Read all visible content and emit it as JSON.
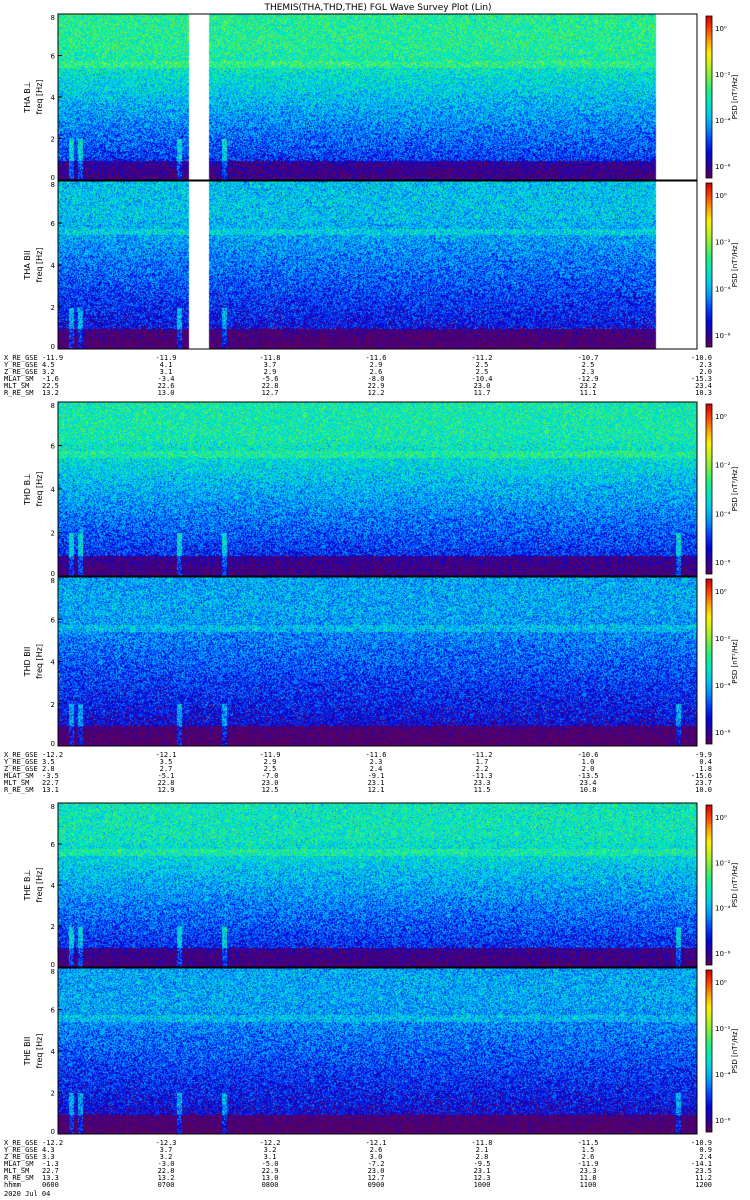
{
  "figure": {
    "title": "THEMIS(THA,THD,THE) FGL Wave Survey Plot (Lin)",
    "date_label": "2020 Jul 04"
  },
  "colors": {
    "colormap": [
      "#5a0060",
      "#2c00a0",
      "#0008d8",
      "#0040ff",
      "#0090ff",
      "#00c8f0",
      "#00e8c0",
      "#20f080",
      "#70f040",
      "#c0f020",
      "#fff000",
      "#ffa000",
      "#ff4000",
      "#d00000"
    ],
    "background": "#ffffff",
    "axis": "#000000"
  },
  "chart_data": [
    {
      "type": "heatmap",
      "id": "THA_BL",
      "ylabel_top": "THA B⊥",
      "ylabel": "freq [Hz]",
      "ylim": [
        0,
        8
      ],
      "yticks": [
        "0",
        "2",
        "4",
        "6",
        "8"
      ],
      "zlabel": "PSD [nT²/Hz]",
      "zticks": [
        "10⁰",
        "10⁻²",
        "10⁻⁴",
        "10⁻⁶"
      ],
      "zscale": "log",
      "xlim": [
        "0600",
        "1200"
      ],
      "background_level": 0.72,
      "data_gaps": [
        [
          0.205,
          0.235
        ],
        [
          0.935,
          1.0
        ]
      ]
    },
    {
      "type": "heatmap",
      "id": "THA_BII",
      "ylabel_top": "THA BII",
      "ylabel": "freq [Hz]",
      "ylim": [
        0,
        8
      ],
      "yticks": [
        "0",
        "2",
        "4",
        "6",
        "8"
      ],
      "zlabel": "PSD [nT²/Hz]",
      "zticks": [
        "10⁰",
        "10⁻²",
        "10⁻⁴",
        "10⁻⁶"
      ],
      "zscale": "log",
      "xlim": [
        "0600",
        "1200"
      ],
      "background_level": 0.55,
      "data_gaps": [
        [
          0.205,
          0.235
        ],
        [
          0.935,
          1.0
        ]
      ]
    },
    {
      "type": "heatmap",
      "id": "THD_BL",
      "ylabel_top": "THD B⊥",
      "ylabel": "freq [Hz]",
      "ylim": [
        0,
        8
      ],
      "yticks": [
        "0",
        "2",
        "4",
        "6",
        "8"
      ],
      "zlabel": "PSD [nT²/Hz]",
      "zticks": [
        "10⁰",
        "10⁻²",
        "10⁻⁴",
        "10⁻⁶"
      ],
      "zscale": "log",
      "xlim": [
        "0600",
        "1200"
      ],
      "background_level": 0.68,
      "data_gaps": []
    },
    {
      "type": "heatmap",
      "id": "THD_BII",
      "ylabel_top": "THD BII",
      "ylabel": "freq [Hz]",
      "ylim": [
        0,
        8
      ],
      "yticks": [
        "0",
        "2",
        "4",
        "6",
        "8"
      ],
      "zlabel": "PSD [nT²/Hz]",
      "zticks": [
        "10⁰",
        "10⁻²",
        "10⁻⁴",
        "10⁻⁶"
      ],
      "zscale": "log",
      "xlim": [
        "0600",
        "1200"
      ],
      "background_level": 0.5,
      "data_gaps": []
    },
    {
      "type": "heatmap",
      "id": "THE_BL",
      "ylabel_top": "THE B⊥",
      "ylabel": "freq [Hz]",
      "ylim": [
        0,
        8
      ],
      "yticks": [
        "0",
        "2",
        "4",
        "6",
        "8"
      ],
      "zlabel": "PSD [nT²/Hz]",
      "zticks": [
        "10⁰",
        "10⁻²",
        "10⁻⁴",
        "10⁻⁶"
      ],
      "zscale": "log",
      "xlim": [
        "0600",
        "1200"
      ],
      "background_level": 0.66,
      "data_gaps": []
    },
    {
      "type": "heatmap",
      "id": "THE_BII",
      "ylabel_top": "THE BII",
      "ylabel": "freq [Hz]",
      "ylim": [
        0,
        8
      ],
      "yticks": [
        "0",
        "2",
        "4",
        "6",
        "8"
      ],
      "zlabel": "PSD [nT²/Hz]",
      "zticks": [
        "10⁰",
        "10⁻²",
        "10⁻⁴",
        "10⁻⁶"
      ],
      "zscale": "log",
      "xlim": [
        "0600",
        "1200"
      ],
      "background_level": 0.5,
      "data_gaps": []
    }
  ],
  "ephemeris": [
    {
      "probe": "THA",
      "rows": [
        {
          "label": "X_RE_GSE",
          "values": [
            "-11.9",
            "-11.9",
            "-11.8",
            "-11.6",
            "-11.2",
            "-10.7",
            "-10.0"
          ]
        },
        {
          "label": "Y_RE_GSE",
          "values": [
            "4.5",
            "4.1",
            "3.7",
            "2.9",
            "2.5",
            "2.5",
            "2.3"
          ]
        },
        {
          "label": "Z_RE_GSE",
          "values": [
            "3.2",
            "3.1",
            "2.9",
            "2.6",
            "2.5",
            "2.3",
            "2.0"
          ]
        },
        {
          "label": "MLAT_SM",
          "values": [
            "-1.6",
            "-3.4",
            "-5.6",
            "-8.0",
            "-10.4",
            "-12.9",
            "-15.3"
          ]
        },
        {
          "label": "MLT_SM",
          "values": [
            "22.5",
            "22.6",
            "22.8",
            "22.9",
            "23.0",
            "23.2",
            "23.4"
          ]
        },
        {
          "label": "R_RE_SM",
          "values": [
            "13.2",
            "13.0",
            "12.7",
            "12.2",
            "11.7",
            "11.1",
            "10.3"
          ]
        }
      ]
    },
    {
      "probe": "THD",
      "rows": [
        {
          "label": "X_RE_GSE",
          "values": [
            "-12.2",
            "-12.1",
            "-11.9",
            "-11.6",
            "-11.2",
            "-10.6",
            "-9.9"
          ]
        },
        {
          "label": "Y_RE_GSE",
          "values": [
            "3.5",
            "3.5",
            "2.9",
            "2.3",
            "1.7",
            "1.0",
            "0.4"
          ]
        },
        {
          "label": "Z_RE_GSE",
          "values": [
            "2.8",
            "2.7",
            "2.5",
            "2.4",
            "2.2",
            "2.0",
            "1.8"
          ]
        },
        {
          "label": "MLAT_SM",
          "values": [
            "-3.5",
            "-5.1",
            "-7.0",
            "-9.1",
            "-11.3",
            "-13.5",
            "-15.6"
          ]
        },
        {
          "label": "MLT_SM",
          "values": [
            "22.7",
            "22.8",
            "23.0",
            "23.1",
            "23.3",
            "23.4",
            "23.7"
          ]
        },
        {
          "label": "R_RE_SM",
          "values": [
            "13.1",
            "12.9",
            "12.5",
            "12.1",
            "11.5",
            "10.8",
            "10.0"
          ]
        }
      ]
    },
    {
      "probe": "THE",
      "rows": [
        {
          "label": "X_RE_GSE",
          "values": [
            "-12.2",
            "-12.3",
            "-12.2",
            "-12.1",
            "-11.8",
            "-11.5",
            "-10.9"
          ]
        },
        {
          "label": "Y_RE_GSE",
          "values": [
            "4.3",
            "3.7",
            "3.2",
            "2.6",
            "2.1",
            "1.5",
            "0.9"
          ]
        },
        {
          "label": "Z_RE_GSE",
          "values": [
            "3.3",
            "3.2",
            "3.1",
            "3.0",
            "2.8",
            "2.6",
            "2.4"
          ]
        },
        {
          "label": "MLAT_SM",
          "values": [
            "-1.3",
            "-3.0",
            "-5.0",
            "-7.2",
            "-9.5",
            "-11.9",
            "-14.1"
          ]
        },
        {
          "label": "MLT_SM",
          "values": [
            "22.7",
            "22.8",
            "22.9",
            "23.0",
            "23.1",
            "23.3",
            "23.5"
          ]
        },
        {
          "label": "R_RE_SM",
          "values": [
            "13.3",
            "13.2",
            "13.0",
            "12.7",
            "12.3",
            "11.8",
            "11.2"
          ]
        }
      ]
    }
  ],
  "time_axis": {
    "label": "hhmm",
    "values": [
      "0600",
      "0700",
      "0800",
      "0900",
      "1000",
      "1100",
      "1200"
    ]
  }
}
